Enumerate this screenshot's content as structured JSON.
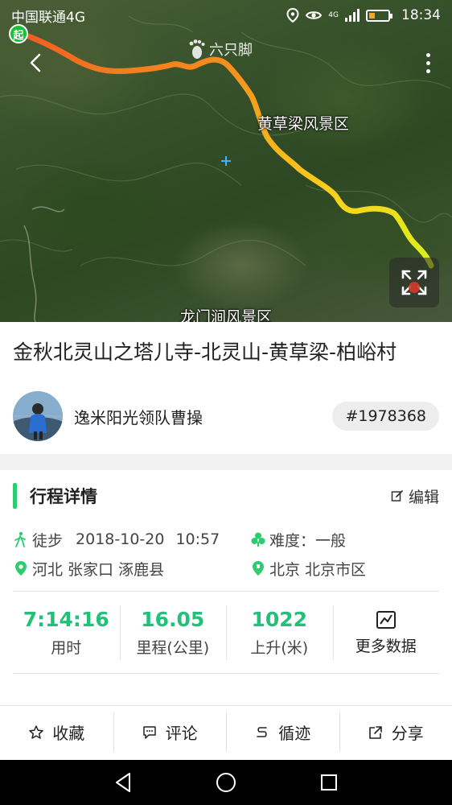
{
  "status_bar": {
    "carrier": "中国联通4G",
    "time": "18:34",
    "network_badge": "4G"
  },
  "map": {
    "brand_label": "六只脚",
    "labels": {
      "scenic_1": "黄草梁风景区",
      "scenic_2": "龙门涧风景区"
    },
    "start_badge": "起",
    "icons": {
      "back": "back-arrow-icon",
      "more": "more-vertical-icon",
      "expand": "expand-icon"
    }
  },
  "trip": {
    "title": "金秋北灵山之塔儿寺-北灵山-黄草梁-柏峪村",
    "author": "逸米阳光领队曹操",
    "id_tag": "#1978368"
  },
  "details": {
    "section_title": "行程详情",
    "edit_label": "编辑",
    "activity": "徒步",
    "date": "2018-10-20",
    "time": "10:57",
    "difficulty": "难度：一般",
    "start_location": "河北 张家口 涿鹿县",
    "end_location": "北京 北京市区"
  },
  "stats": {
    "duration": {
      "value": "7:14:16",
      "label": "用时"
    },
    "distance": {
      "value": "16.05",
      "label": "里程(公里)"
    },
    "ascent": {
      "value": "1022",
      "label": "上升(米)"
    },
    "more_label": "更多数据"
  },
  "actions": {
    "favorite": "收藏",
    "comment": "评论",
    "follow_track": "循迹",
    "share": "分享"
  },
  "colors": {
    "accent": "#22c17a",
    "section_bar": "#2ecc71",
    "start_badge": "#1bbf3a"
  }
}
